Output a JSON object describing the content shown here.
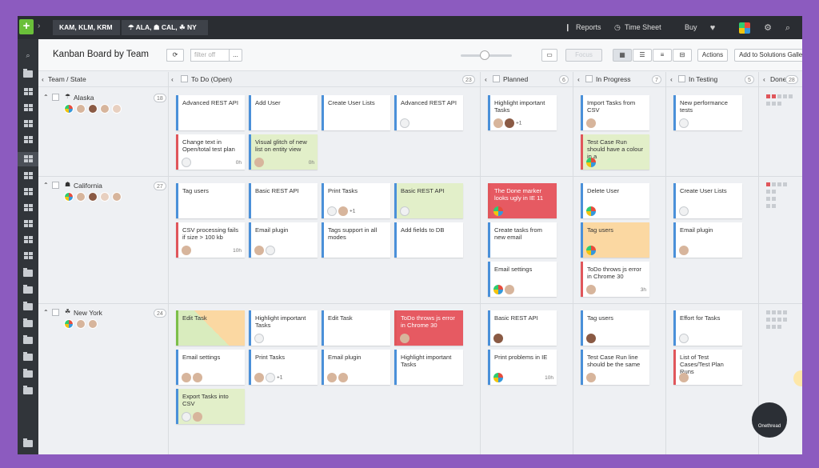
{
  "topbar": {
    "crumb1": "KAM, KLM, KRM",
    "crumb2": "☂ ALA, ☗ CAL, ☘ NY",
    "reports": "Reports",
    "timesheet": "Time Sheet",
    "buy": "Buy"
  },
  "header": {
    "title": "Kanban Board by Team",
    "filter_placeholder": "filter off",
    "more": "...",
    "faded_btn": "Focus",
    "actions": "Actions",
    "gallery": "Add to Solutions Gallery"
  },
  "columns": {
    "team_state": "Team / State",
    "todo": "To Do (Open)",
    "todo_count": "23",
    "planned": "Planned",
    "planned_count": "6",
    "inprogress": "In Progress",
    "inprogress_count": "7",
    "intesting": "In Testing",
    "intesting_count": "5",
    "done": "Done",
    "done_count": "28"
  },
  "teams": {
    "alaska": {
      "name": "Alaska",
      "count": "18"
    },
    "california": {
      "name": "California",
      "count": "27"
    },
    "newyork": {
      "name": "New York",
      "count": "24"
    }
  },
  "cards": {
    "a1": "Advanced REST API",
    "a2": "Add User",
    "a3": "Create User Lists",
    "a4": "Advanced REST API",
    "a5": "Change text in Open/total test plan",
    "a5h": "0h",
    "a6": "Visual glitch of new list on entity view",
    "a6h": "0h",
    "a7": "Highlight important Tasks",
    "a7plus": "+1",
    "a8": "Import Tasks from CSV",
    "a9": "Test Case Run should have a colour in a",
    "a10": "New performance tests",
    "c1": "Tag users",
    "c2": "Basic REST API",
    "c3": "Print Tasks",
    "c3plus": "+1",
    "c4": "Basic REST API",
    "c5": "CSV processing fails if size > 100 kb",
    "c5h": "10h",
    "c6": "Email plugin",
    "c7": "Tags support in all modes",
    "c8": "Add fields to DB",
    "c9": "The Done marker looks ugly in IE 11",
    "c10": "Create tasks from new email",
    "c11": "Email settings",
    "c12": "Delete User",
    "c13": "Tag users",
    "c14": "ToDo throws js error in Chrome 30",
    "c14h": "3h",
    "c15": "Create User Lists",
    "c16": "Email plugin",
    "n1": "Edit Task",
    "n2": "Highlight important Tasks",
    "n3": "Edit Task",
    "n4": "ToDo throws js error in Chrome 30",
    "n5": "Email settings",
    "n6": "Print Tasks",
    "n6plus": "+1",
    "n7": "Email plugin",
    "n8": "Highlight important Tasks",
    "n9": "Export Tasks into CSV",
    "n10": "Basic REST API",
    "n11": "Print problems in IE",
    "n11h": "10h",
    "n12": "Tag users",
    "n13": "Test Case Run line should be the same",
    "n14": "Effort for Tasks",
    "n15": "List of Test Cases/Test Plan Runs"
  },
  "badge": "Onethread",
  "icons": [
    "plus-icon",
    "chevron-right-icon",
    "reports-icon",
    "clock-icon",
    "heart-icon",
    "gear-icon",
    "search-icon",
    "refresh-icon",
    "folder-icon",
    "board-icon"
  ]
}
